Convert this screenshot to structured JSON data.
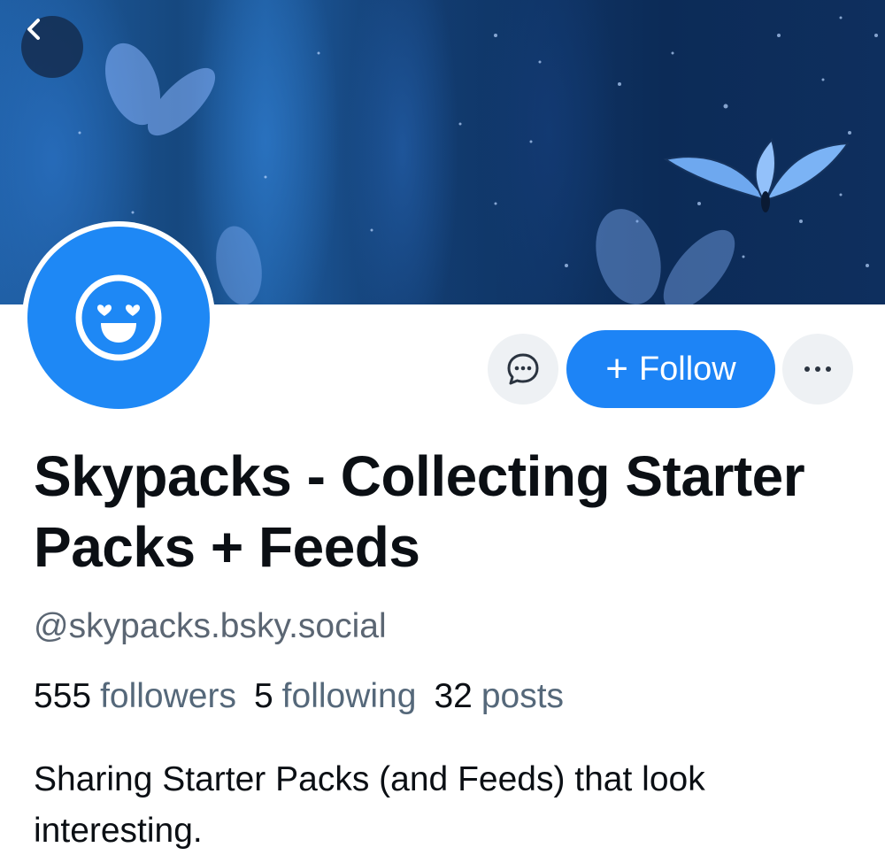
{
  "profile": {
    "display_name": "Skypacks - Collecting Starter Packs + Feeds",
    "handle": "@skypacks.bsky.social",
    "bio": "Sharing Starter Packs (and Feeds) that look interesting."
  },
  "stats": {
    "followers_count": "555",
    "followers_label": "followers",
    "following_count": "5",
    "following_label": "following",
    "posts_count": "32",
    "posts_label": "posts"
  },
  "actions": {
    "follow_label": "Follow",
    "follow_icon": "plus-icon",
    "message_icon": "chat-bubble-icon",
    "more_icon": "ellipsis-icon"
  },
  "header": {
    "back_icon": "chevron-left-icon",
    "banner_image": "blue-butterflies-forest-image"
  },
  "avatar": {
    "icon": "smiling-face-with-heart-eyes-icon",
    "color": "#1e88f5"
  },
  "colors": {
    "accent": "#1d84f6",
    "text_primary": "#0b0f14",
    "text_secondary": "#5b6673"
  }
}
